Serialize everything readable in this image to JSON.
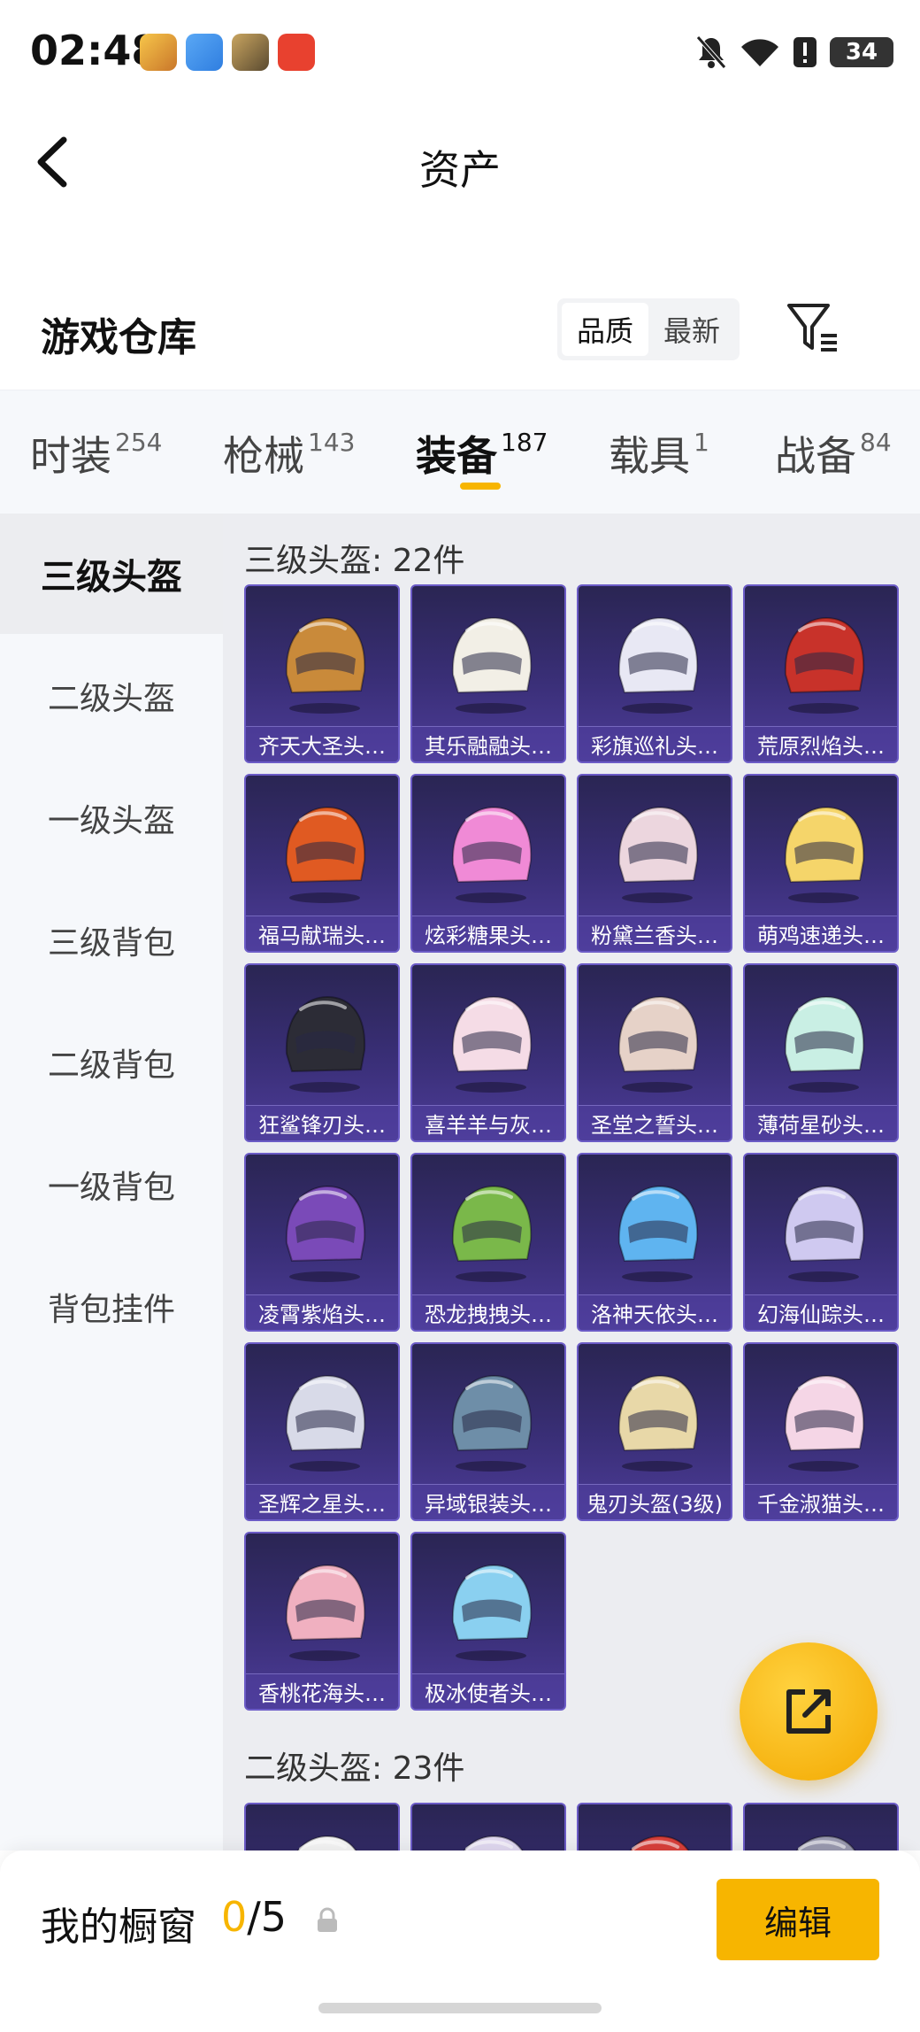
{
  "status_bar": {
    "time": "02:48",
    "battery": "34"
  },
  "nav": {
    "title": "资产"
  },
  "warehouse": {
    "title": "游戏仓库",
    "sort_options": [
      "品质",
      "最新"
    ]
  },
  "tabs": [
    {
      "label": "时装",
      "count": "254"
    },
    {
      "label": "枪械",
      "count": "143"
    },
    {
      "label": "装备",
      "count": "187"
    },
    {
      "label": "载具",
      "count": "1"
    },
    {
      "label": "战备",
      "count": "84"
    }
  ],
  "sidebar": [
    "三级头盔",
    "二级头盔",
    "一级头盔",
    "三级背包",
    "二级背包",
    "一级背包",
    "背包挂件"
  ],
  "section1": {
    "title": "三级头盔: 22件"
  },
  "items": [
    "齐天大圣头…",
    "其乐融融头…",
    "彩旗巡礼头…",
    "荒原烈焰头…",
    "福马献瑞头…",
    "炫彩糖果头…",
    "粉黛兰香头…",
    "萌鸡速递头…",
    "狂鲨锋刃头…",
    "喜羊羊与灰…",
    "圣堂之誓头…",
    "薄荷星砂头…",
    "凌霄紫焰头…",
    "恐龙拽拽头…",
    "洛神天依头…",
    "幻海仙踪头…",
    "圣辉之星头…",
    "异域银装头…",
    "鬼刃头盔(3级)",
    "千金淑猫头…",
    "香桃花海头…",
    "极冰使者头…"
  ],
  "item_colors": [
    "#c98a3a",
    "#f2efe6",
    "#e8e8f4",
    "#c8322a",
    "#e05a22",
    "#f08ad6",
    "#ecd6de",
    "#f5d56a",
    "#2c2c36",
    "#f5dce6",
    "#e6d2c8",
    "#c9efe4",
    "#7a4ab8",
    "#7ab84a",
    "#5fb4f0",
    "#cfc9f0",
    "#d8dae8",
    "#6e8ea8",
    "#e8d8a8",
    "#f5d6e6",
    "#f0b0c0",
    "#8ad0f0"
  ],
  "section2": {
    "title": "二级头盔: 23件"
  },
  "section2_colors": [
    "#f4f4f4",
    "#e0d8f0",
    "#d8403a",
    "#9a9ab0"
  ],
  "bottom": {
    "title": "我的橱窗",
    "current": "0",
    "total": "/5",
    "edit_label": "编辑"
  }
}
